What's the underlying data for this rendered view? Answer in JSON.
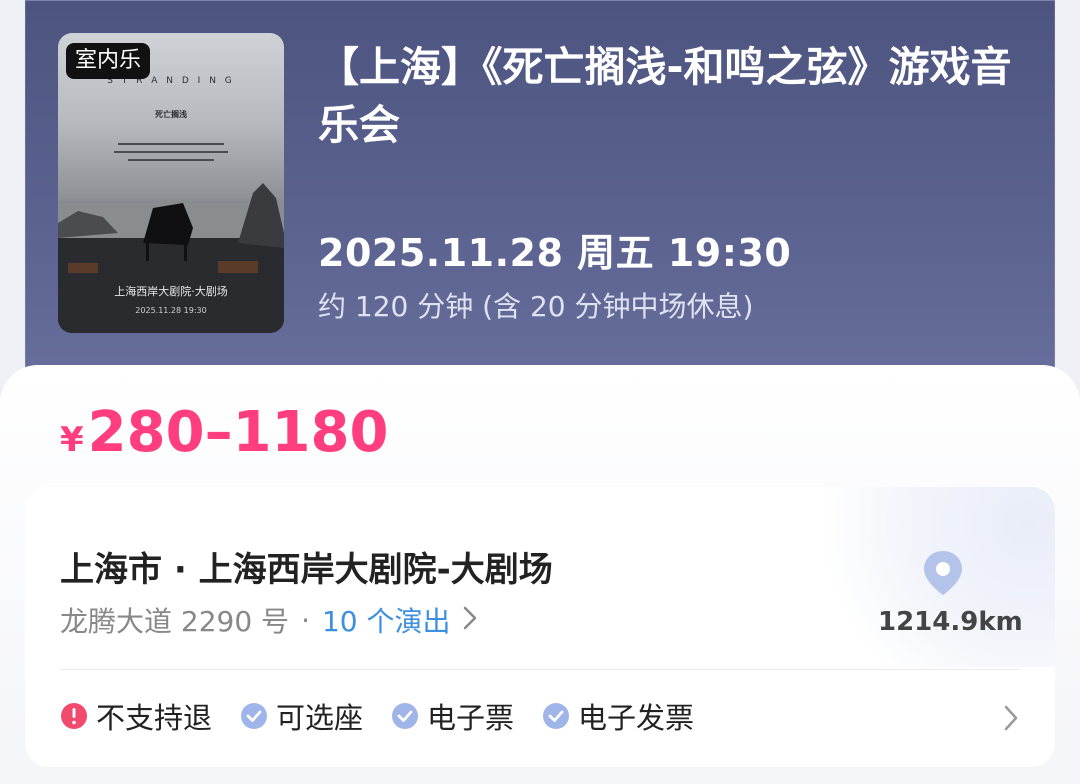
{
  "event": {
    "category_tag": "室内乐",
    "title": "【上海】《死亡搁浅-和鸣之弦》游戏音乐会",
    "datetime": "2025.11.28 周五 19:30",
    "duration": "约 120 分钟 (含 20 分钟中场休息)"
  },
  "price": {
    "currency": "¥",
    "range": "280–1180",
    "color": "#ff3d7f"
  },
  "venue": {
    "name": "上海市 · 上海西岸大剧院-大剧场",
    "address": "龙腾大道 2290 号",
    "separator": "·",
    "shows_link": "10 个演出",
    "distance": "1214.9km",
    "link_color": "#3d8fe0"
  },
  "features": [
    {
      "label": "不支持退",
      "icon": "exclamation-icon",
      "color": "#f24a6e"
    },
    {
      "label": "可选座",
      "icon": "check-icon",
      "color": "#9fb5ea"
    },
    {
      "label": "电子票",
      "icon": "check-icon",
      "color": "#9fb5ea"
    },
    {
      "label": "电子发票",
      "icon": "check-icon",
      "color": "#9fb5ea"
    }
  ]
}
